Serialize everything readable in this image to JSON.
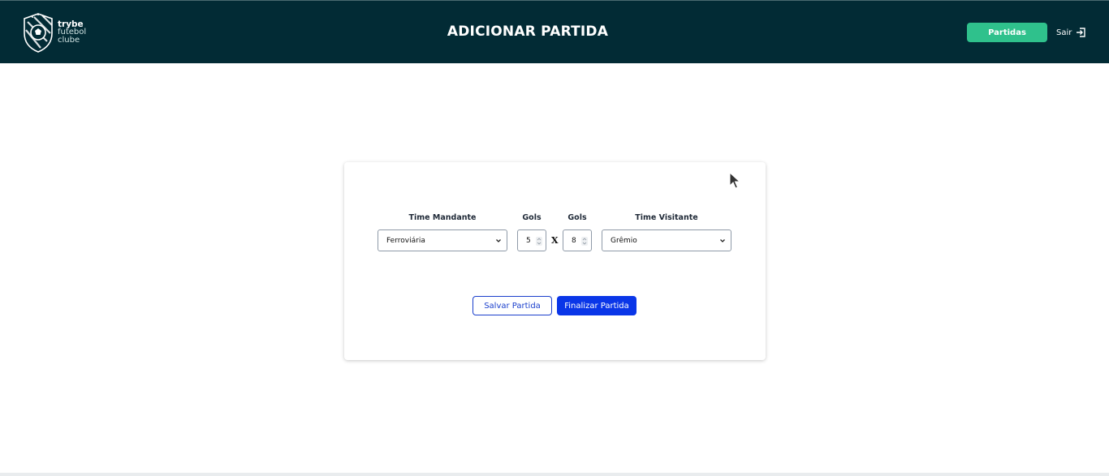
{
  "header": {
    "logo": {
      "line1": "trybe",
      "line2": "futebol",
      "line3": "clube"
    },
    "title": "ADICIONAR PARTIDA",
    "partidas_label": "Partidas",
    "sair_label": "Sair"
  },
  "form": {
    "home_team_label": "Time Mandante",
    "home_goals_label": "Gols",
    "away_goals_label": "Gols",
    "away_team_label": "Time Visitante",
    "home_team_value": "Ferroviária",
    "home_goals_value": "5",
    "separator": "X",
    "away_goals_value": "8",
    "away_team_value": "Grêmio",
    "save_label": "Salvar Partida",
    "finish_label": "Finalizar Partida"
  },
  "colors": {
    "header_bg": "#022b35",
    "partidas_bg": "#2fc18c",
    "primary_blue": "#0a36e8"
  },
  "icons": {
    "logo": "soccer-ball-shield-icon",
    "sair": "exit-icon",
    "select": "chevron-down-icon",
    "spinner": "spinner-icon",
    "pointer": "cursor-icon"
  }
}
